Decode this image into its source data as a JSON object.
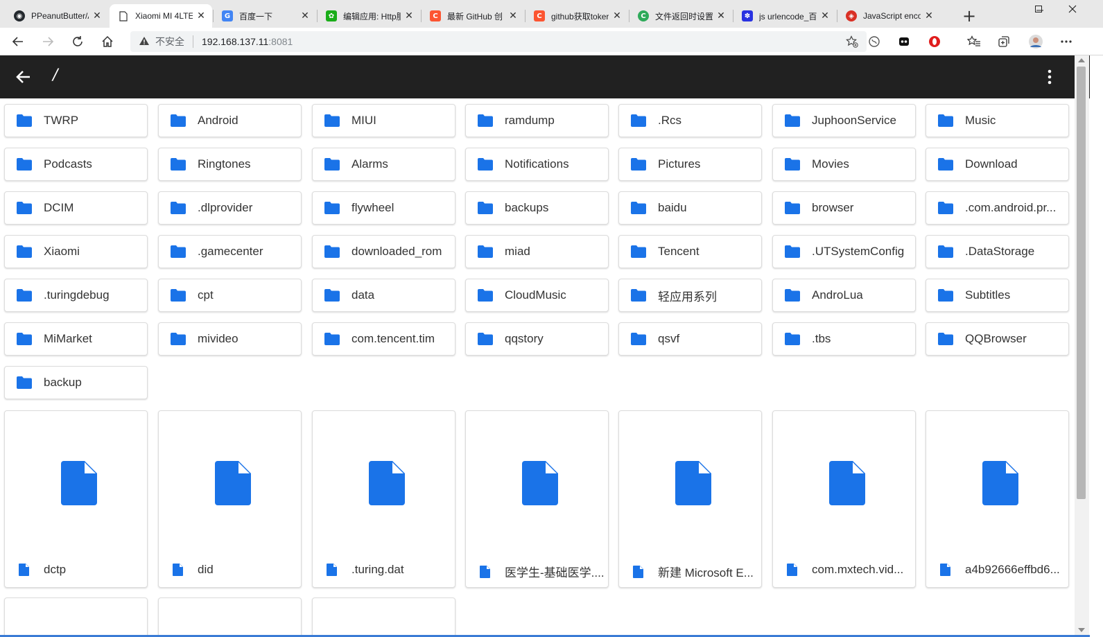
{
  "browser": {
    "tabs": [
      {
        "title": "PPeanutButter/A",
        "icon": "github-icon",
        "color": "#24292e",
        "glyph": "◉"
      },
      {
        "title": "Xiaomi MI 4LTE",
        "icon": "page-icon",
        "color": "#ffffff",
        "glyph": ""
      },
      {
        "title": "百度一下",
        "icon": "google-icon",
        "color": "#4285f4",
        "glyph": "G"
      },
      {
        "title": "编辑应用: Http服",
        "icon": "app-icon",
        "color": "#1aad19",
        "glyph": "✿"
      },
      {
        "title": "最新 GitHub 创",
        "icon": "csdn-icon",
        "color": "#fc5531",
        "glyph": "C"
      },
      {
        "title": "github获取toker",
        "icon": "csdn-icon",
        "color": "#fc5531",
        "glyph": "C"
      },
      {
        "title": "文件返回时设置",
        "icon": "c-icon",
        "color": "#2eaa5a",
        "glyph": "C"
      },
      {
        "title": "js urlencode_百",
        "icon": "baidu-paw-icon",
        "color": "#2932e1",
        "glyph": "✽"
      },
      {
        "title": "JavaScript encoc",
        "icon": "runoob-icon",
        "color": "#d93025",
        "glyph": "◈"
      }
    ],
    "tab_close": "✕",
    "new_tab": "+",
    "address": {
      "insecure_label": "不安全",
      "host": "192.168.137.11",
      "port": ":8081"
    }
  },
  "app": {
    "path": "/"
  },
  "folders": [
    "TWRP",
    "Android",
    "MIUI",
    "ramdump",
    ".Rcs",
    "JuphoonService",
    "Music",
    "Podcasts",
    "Ringtones",
    "Alarms",
    "Notifications",
    "Pictures",
    "Movies",
    "Download",
    "DCIM",
    ".dlprovider",
    "flywheel",
    "backups",
    "baidu",
    "browser",
    ".com.android.pr...",
    "Xiaomi",
    ".gamecenter",
    "downloaded_rom",
    "miad",
    "Tencent",
    ".UTSystemConfig",
    ".DataStorage",
    ".turingdebug",
    "cpt",
    "data",
    "CloudMusic",
    "轻应用系列",
    "AndroLua",
    "Subtitles",
    "MiMarket",
    "mivideo",
    "com.tencent.tim",
    "qqstory",
    "qsvf",
    ".tbs",
    "QQBrowser",
    "backup"
  ],
  "files": [
    "dctp",
    "did",
    ".turing.dat",
    "医学生-基础医学....",
    "新建 Microsoft E...",
    "com.mxtech.vid...",
    "a4b92666effbd6..."
  ],
  "colors": {
    "accent": "#1a73e8",
    "appbar": "#212121"
  }
}
